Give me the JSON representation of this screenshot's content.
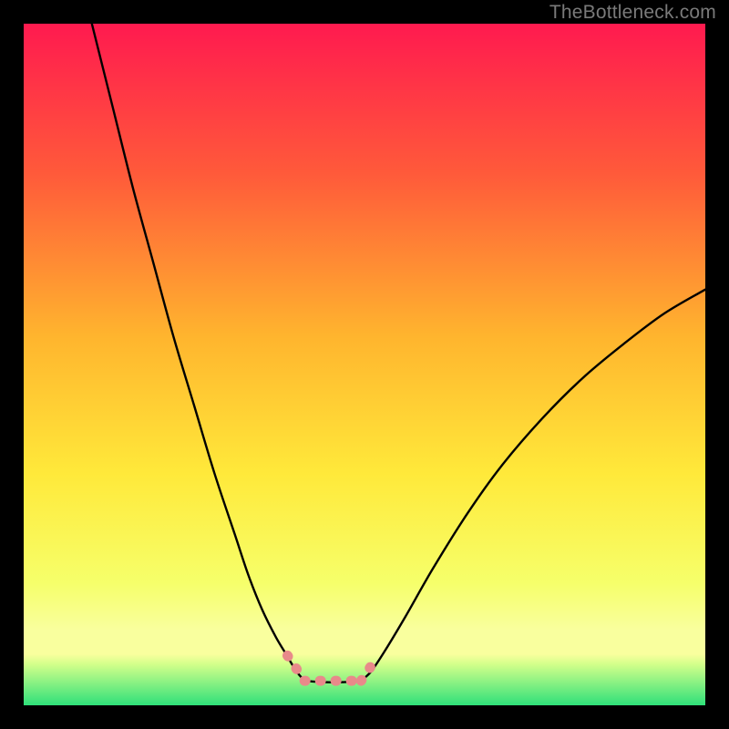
{
  "watermark": "TheBottleneck.com",
  "colors": {
    "page_bg": "#000000",
    "grad_top": "#ff1a4f",
    "grad_mid1": "#ff5a3a",
    "grad_mid2": "#ffb52e",
    "grad_mid3": "#ffe93a",
    "grad_mid4": "#f6ff6a",
    "grad_band": "#f9ff9e",
    "grad_green": "#2fe07a",
    "curve": "#000000",
    "accent": "#e88a8a"
  },
  "chart_data": {
    "type": "line",
    "title": "",
    "xlabel": "",
    "ylabel": "",
    "xlim": [
      0,
      100
    ],
    "ylim": [
      0,
      100
    ],
    "series": [
      {
        "name": "left-curve",
        "x": [
          10,
          13,
          16,
          19,
          22,
          25,
          28,
          31,
          33,
          35,
          37,
          38.5,
          40,
          41.2
        ],
        "y": [
          100,
          88,
          76,
          65,
          54,
          44,
          34,
          25,
          19,
          14,
          10,
          7.5,
          5,
          3.6
        ]
      },
      {
        "name": "right-curve",
        "x": [
          49.5,
          51,
          53,
          56,
          60,
          65,
          70,
          76,
          82,
          88,
          94,
          100
        ],
        "y": [
          3.6,
          5,
          8,
          13,
          20,
          28,
          35,
          42,
          48,
          53,
          57.5,
          61
        ]
      },
      {
        "name": "flat-bottom",
        "x": [
          41.2,
          44,
          47,
          49.5
        ],
        "y": [
          3.6,
          3.4,
          3.4,
          3.6
        ]
      }
    ],
    "accent_segments": [
      {
        "x": [
          38.7,
          41.2
        ],
        "y": [
          7.3,
          3.6
        ]
      },
      {
        "x": [
          41.2,
          49.5
        ],
        "y": [
          3.6,
          3.6
        ]
      },
      {
        "x": [
          49.5,
          51.8
        ],
        "y": [
          3.6,
          7.0
        ]
      }
    ]
  }
}
